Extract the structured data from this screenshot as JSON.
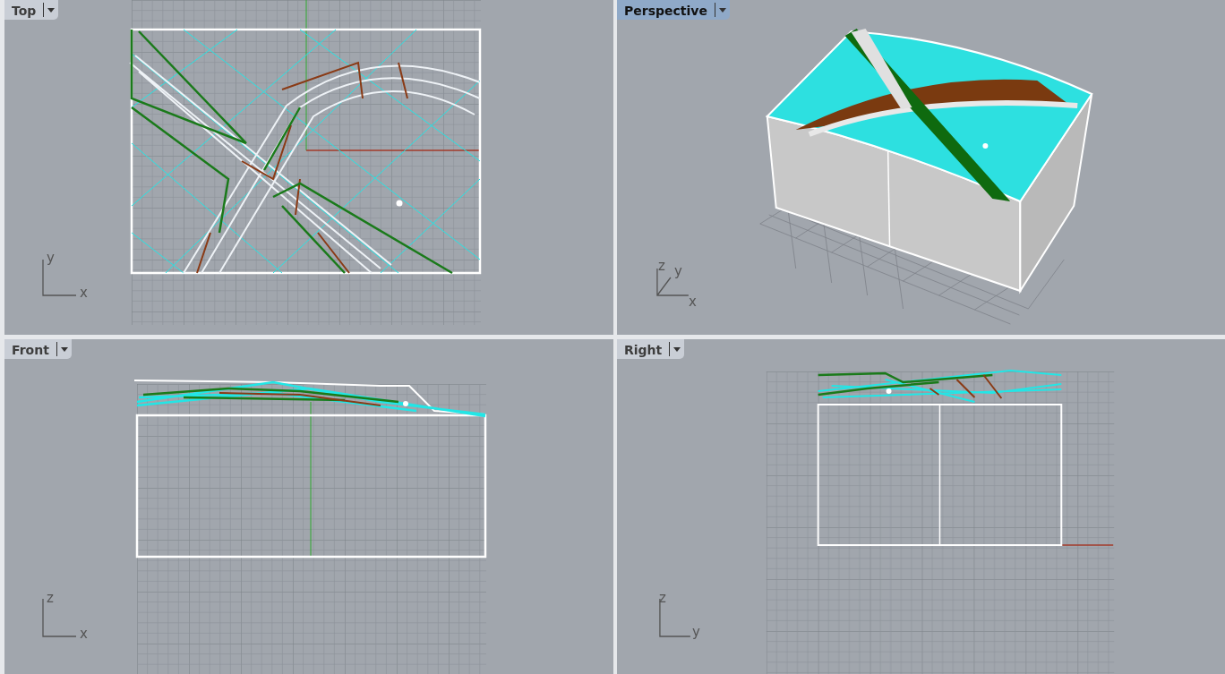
{
  "viewports": [
    {
      "title": "Top",
      "kind": "top",
      "selected": false,
      "axes": [
        "y",
        "x"
      ]
    },
    {
      "title": "Perspective",
      "kind": "perspective",
      "selected": true,
      "axes": [
        "z",
        "y",
        "x"
      ]
    },
    {
      "title": "Front",
      "kind": "front",
      "selected": false,
      "axes": [
        "z",
        "x"
      ]
    },
    {
      "title": "Right",
      "kind": "right",
      "selected": false,
      "axes": [
        "z",
        "y"
      ]
    }
  ]
}
